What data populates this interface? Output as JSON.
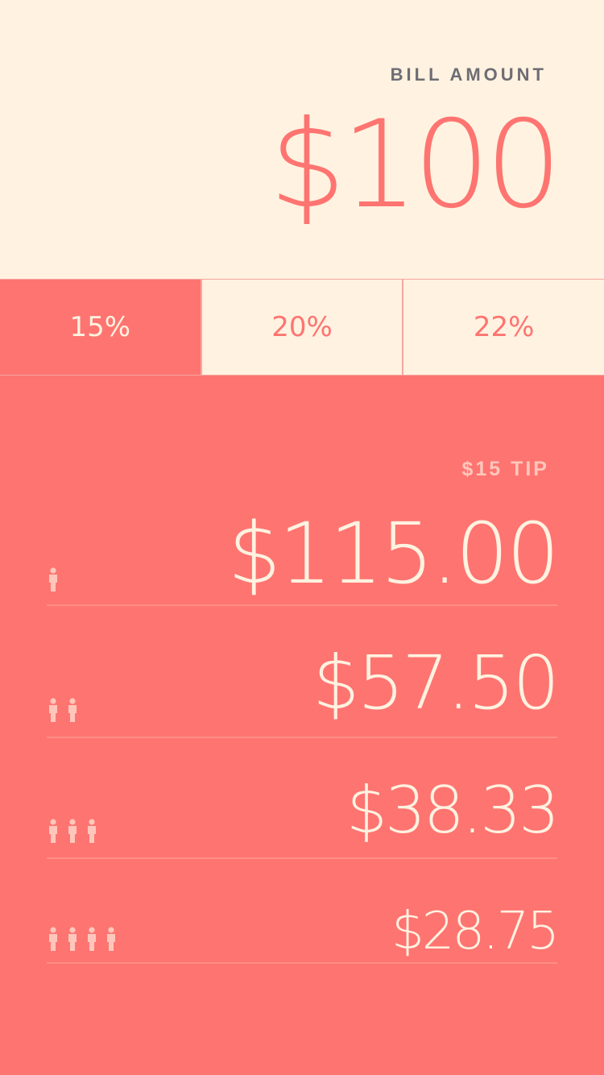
{
  "bill": {
    "label": "BILL AMOUNT",
    "amount": "$100"
  },
  "tip_options": [
    {
      "label": "15%",
      "selected": true
    },
    {
      "label": "20%",
      "selected": false
    },
    {
      "label": "22%",
      "selected": false
    }
  ],
  "tip_label": "$15 TIP",
  "splits": [
    {
      "people": 1,
      "amount": "$115.00",
      "icon": "person-icon"
    },
    {
      "people": 2,
      "amount": "$57.50",
      "icon": "person-icon"
    },
    {
      "people": 3,
      "amount": "$38.33",
      "icon": "person-icon"
    },
    {
      "people": 4,
      "amount": "$28.75",
      "icon": "person-icon"
    }
  ],
  "colors": {
    "cream": "#fff2e0",
    "coral": "#fe7471",
    "label_gray": "#6d6d74",
    "tip_label": "#ffc7bb",
    "person_icon": "#ffc7bb"
  }
}
